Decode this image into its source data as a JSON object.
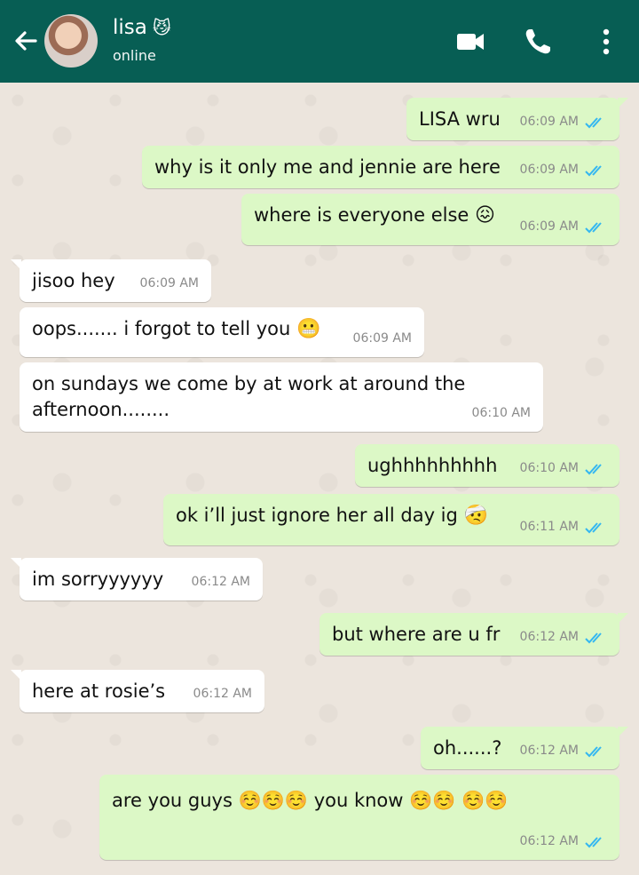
{
  "header": {
    "contact_name": "lisa",
    "name_emoji": "😼",
    "status": "online",
    "icons": [
      "back-arrow-icon",
      "video-call-icon",
      "voice-call-icon",
      "more-vert-icon"
    ],
    "color": "#075e54"
  },
  "colors": {
    "outgoing": "#dcf8c6",
    "incoming": "#ffffff",
    "ticks": "#34b7f1"
  },
  "messages": [
    {
      "dir": "out",
      "text": "LISA wru",
      "time": "06:09 AM"
    },
    {
      "dir": "out",
      "text": "why is it only me and jennie are here",
      "time": "06:09 AM"
    },
    {
      "dir": "out",
      "text": "where is everyone else",
      "emoji": "😖",
      "time": "06:09 AM"
    },
    {
      "dir": "in",
      "text": "jisoo hey",
      "time": "06:09 AM"
    },
    {
      "dir": "in",
      "text": "oops....... i forgot to tell you",
      "emoji": "😬",
      "time": "06:09 AM"
    },
    {
      "dir": "in",
      "text": "on sundays we come by at work at around the afternoon........",
      "time": "06:10 AM"
    },
    {
      "dir": "out",
      "text": "ughhhhhhhhh",
      "time": "06:10 AM"
    },
    {
      "dir": "out",
      "text": "ok i’ll just ignore her all day ig",
      "emoji": "🤕",
      "time": "06:11 AM"
    },
    {
      "dir": "in",
      "text": "im sorryyyyyy",
      "time": "06:12 AM"
    },
    {
      "dir": "out",
      "text": "but where are u fr",
      "time": "06:12 AM"
    },
    {
      "dir": "in",
      "text": "here at rosie’s",
      "time": "06:12 AM"
    },
    {
      "dir": "out",
      "text": "oh......?",
      "time": "06:12 AM"
    },
    {
      "dir": "out",
      "text": "are you guys ☺️☺️☺️ you know ☺️☺️ ☺️☺️",
      "time": "06:12 AM"
    }
  ]
}
